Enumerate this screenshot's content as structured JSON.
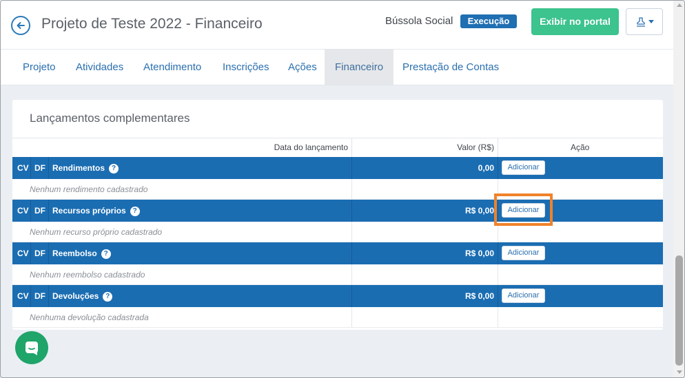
{
  "header": {
    "title": "Projeto de Teste 2022 - Financeiro",
    "org_name": "Bússola Social",
    "status_badge": "Execução",
    "portal_button": "Exibir no portal",
    "back_icon": "arrow-left-icon",
    "export_icon": "stamp-icon"
  },
  "tabs": [
    {
      "label": "Projeto",
      "active": false
    },
    {
      "label": "Atividades",
      "active": false
    },
    {
      "label": "Atendimento",
      "active": false
    },
    {
      "label": "Inscrições",
      "active": false
    },
    {
      "label": "Ações",
      "active": false
    },
    {
      "label": "Financeiro",
      "active": true
    },
    {
      "label": "Prestação de Contas",
      "active": false
    }
  ],
  "card": {
    "title": "Lançamentos complementares",
    "columns": {
      "date": "Data do lançamento",
      "value": "Valor (R$)",
      "action": "Ação"
    }
  },
  "sections": [
    {
      "cv": "CV",
      "df": "DF",
      "name": "Rendimentos",
      "value": "0,00",
      "button": "Adicionar",
      "empty": "Nenhum rendimento cadastrado"
    },
    {
      "cv": "CV",
      "df": "DF",
      "name": "Recursos próprios",
      "value": "R$ 0,00",
      "button": "Adicionar",
      "empty": "Nenhum recurso próprio cadastrado"
    },
    {
      "cv": "CV",
      "df": "DF",
      "name": "Reembolso",
      "value": "R$ 0,00",
      "button": "Adicionar",
      "empty": "Nenhum reembolso cadastrado"
    },
    {
      "cv": "CV",
      "df": "DF",
      "name": "Devoluções",
      "value": "R$ 0,00",
      "button": "Adicionar",
      "empty": "Nenhuma devolução cadastrada"
    }
  ],
  "help_glyph": "?",
  "colors": {
    "primary": "#1b6db2",
    "success": "#3cc38e",
    "highlight": "#f0822a",
    "chat": "#1fa46a"
  }
}
